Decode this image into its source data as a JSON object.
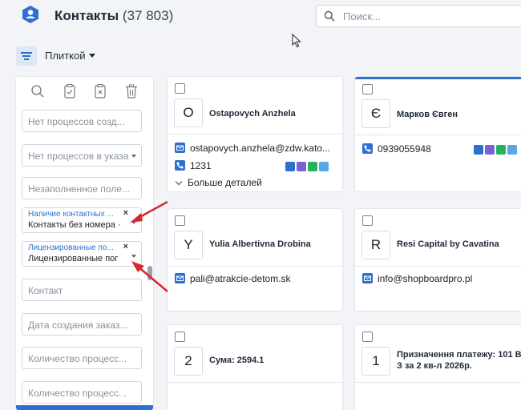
{
  "header": {
    "title": "Контакты",
    "count": "(37 803)",
    "search_placeholder": "Поиск..."
  },
  "toolbar": {
    "view_label": "Плиткой"
  },
  "sidebar": {
    "tools": [
      "search-icon",
      "clipboard-check-icon",
      "clipboard-x-icon",
      "trash-icon"
    ],
    "filters": [
      {
        "placeholder": "Нет процессов созд..."
      },
      {
        "placeholder": "Нет процессов в указа",
        "select": true
      },
      {
        "placeholder": "Незаполненное поле..."
      },
      {
        "label": "Наличие контактных ...",
        "value": "Контакты без номера ·"
      },
      {
        "label": "Лицензированные по...",
        "value": "Лицензированные пог"
      },
      {
        "placeholder": "Контакт"
      },
      {
        "placeholder": "Дата создания заказ..."
      },
      {
        "placeholder": "Количество процесс..."
      },
      {
        "placeholder": "Количество процесс..."
      }
    ],
    "clear_symbol": "×"
  },
  "cards": [
    {
      "initial": "O",
      "name": "Ostapovych Anzhela",
      "email": "ostapovych.anzhela@zdw.kato...",
      "phone": "1231",
      "more": "Больше деталей"
    },
    {
      "initial": "Є",
      "name": "Марков Євген",
      "phone": "0939055948"
    },
    {
      "initial": "Y",
      "name": "Yulia Albertivna Drobina",
      "email": "pali@atrakcie-detom.sk"
    },
    {
      "initial": "R",
      "name": "Resi Capital by Cavatina",
      "email": "info@shopboardpro.pl"
    },
    {
      "initial": "2",
      "name": "Сума: 2594.1"
    },
    {
      "initial": "1",
      "name_line1": "Призначення платежу: 101 В",
      "name_line2": "З за 2 кв-л 2026р."
    }
  ],
  "colors": {
    "accent": "#2f6fd0",
    "viber": "#7b61d1",
    "whatsapp": "#25b35a",
    "telegram": "#5aa7e6",
    "arrow": "#d9272e"
  }
}
